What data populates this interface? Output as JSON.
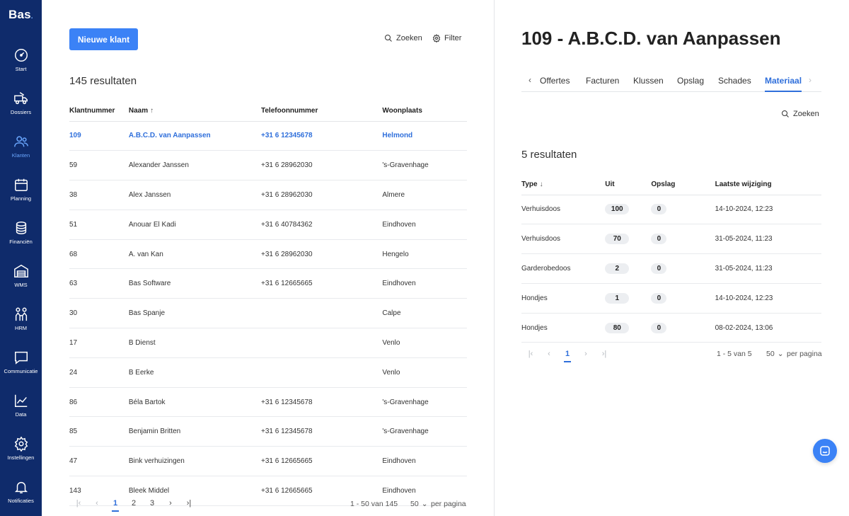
{
  "sidebar": {
    "logo": "Bas",
    "items": [
      {
        "label": "Start",
        "icon": "speedometer-icon"
      },
      {
        "label": "Dossiers",
        "icon": "truck-icon"
      },
      {
        "label": "Klanten",
        "icon": "users-icon"
      },
      {
        "label": "Planning",
        "icon": "calendar-icon"
      },
      {
        "label": "Financiën",
        "icon": "coins-icon"
      },
      {
        "label": "WMS",
        "icon": "warehouse-icon"
      },
      {
        "label": "HRM",
        "icon": "people-icon"
      },
      {
        "label": "Communicatie",
        "icon": "message-icon"
      },
      {
        "label": "Data",
        "icon": "line-chart-icon"
      },
      {
        "label": "Instellingen",
        "icon": "gear-icon"
      },
      {
        "label": "Notificaties",
        "icon": "bell-icon"
      }
    ],
    "active": "Klanten"
  },
  "customers": {
    "new_button": "Nieuwe klant",
    "search_label": "Zoeken",
    "filter_label": "Filter",
    "results": "145 resultaten",
    "columns": [
      "Klantnummer",
      "Naam",
      "Telefoonnummer",
      "Woonplaats"
    ],
    "sort_indicator": "↑",
    "rows": [
      [
        "109",
        "A.B.C.D. van Aanpassen",
        "+31 6 12345678",
        "Helmond"
      ],
      [
        "59",
        "Alexander Janssen",
        "+31 6 28962030",
        "'s-Gravenhage"
      ],
      [
        "38",
        "Alex Janssen",
        "+31 6 28962030",
        "Almere"
      ],
      [
        "51",
        "Anouar El Kadi",
        "+31 6 40784362",
        "Eindhoven"
      ],
      [
        "68",
        "A. van Kan",
        "+31 6 28962030",
        "Hengelo"
      ],
      [
        "63",
        "Bas Software",
        "+31 6 12665665",
        "Eindhoven"
      ],
      [
        "30",
        "Bas Spanje",
        "",
        "Calpe"
      ],
      [
        "17",
        "B Dienst",
        "",
        "Venlo"
      ],
      [
        "24",
        "B Eerke",
        "",
        "Venlo"
      ],
      [
        "86",
        "Béla Bartok",
        "+31 6 12345678",
        "'s-Gravenhage"
      ],
      [
        "85",
        "Benjamin Britten",
        "+31 6 12345678",
        "'s-Gravenhage"
      ],
      [
        "47",
        "Bink verhuizingen",
        "+31 6 12665665",
        "Eindhoven"
      ],
      [
        "143",
        "Bleek Middel",
        "+31 6 12665665",
        "Eindhoven"
      ]
    ],
    "pagination": {
      "pages": [
        "1",
        "2",
        "3"
      ],
      "current": "1",
      "range": "1 - 50 van 145",
      "per_page": "50",
      "per_page_label": "per pagina"
    }
  },
  "detail": {
    "title": "109 - A.B.C.D. van Aanpassen",
    "tabs": [
      "Offertes",
      "Facturen",
      "Klussen",
      "Opslag",
      "Schades",
      "Materiaal"
    ],
    "active_tab": "Materiaal",
    "search_label": "Zoeken",
    "results": "5 resultaten",
    "columns": [
      "Type",
      "Uit",
      "Opslag",
      "Laatste wijziging"
    ],
    "sort_indicator": "↓",
    "rows": [
      [
        "Verhuisdoos",
        "100",
        "0",
        "14-10-2024, 12:23"
      ],
      [
        "Verhuisdoos",
        "70",
        "0",
        "31-05-2024, 11:23"
      ],
      [
        "Garderobedoos",
        "2",
        "0",
        "31-05-2024, 11:23"
      ],
      [
        "Hondjes",
        "1",
        "0",
        "14-10-2024, 12:23"
      ],
      [
        "Hondjes",
        "80",
        "0",
        "08-02-2024, 13:06"
      ]
    ],
    "pagination": {
      "current": "1",
      "range": "1 - 5 van 5",
      "per_page": "50",
      "per_page_label": "per pagina"
    }
  },
  "colors": {
    "sidebar": "#0f2b6b",
    "accent": "#3b82f6",
    "link": "#2f6fdb"
  }
}
